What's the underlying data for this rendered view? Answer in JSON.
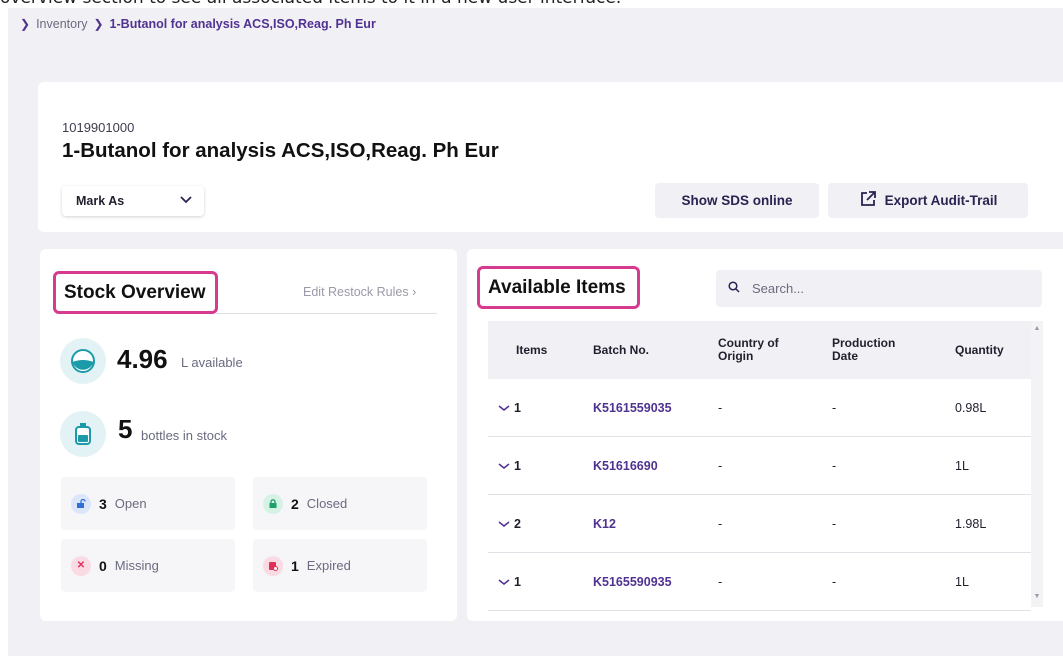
{
  "caption": "overview section to see all associated items to it in a new user interface.",
  "breadcrumb": {
    "items": [
      "Inventory",
      "1-Butanol for analysis ACS,ISO,Reag. Ph Eur"
    ]
  },
  "product": {
    "id": "1019901000",
    "title": "1-Butanol for analysis ACS,ISO,Reag. Ph Eur"
  },
  "header_actions": {
    "mark_as": "Mark As",
    "show_sds": "Show SDS online",
    "export_audit": "Export Audit-Trail"
  },
  "stock": {
    "title": "Stock Overview",
    "restock_link": "Edit Restock Rules",
    "available_value": "4.96",
    "available_unit": "L available",
    "bottles_value": "5",
    "bottles_unit": "bottles in stock",
    "statuses": [
      {
        "count": "3",
        "label": "Open",
        "icon": "unlock-icon",
        "color": "#2f6fd6"
      },
      {
        "count": "2",
        "label": "Closed",
        "icon": "lock-icon",
        "color": "#1f9e6a"
      },
      {
        "count": "0",
        "label": "Missing",
        "icon": "x-icon",
        "color": "#e0305a"
      },
      {
        "count": "1",
        "label": "Expired",
        "icon": "expired-icon",
        "color": "#e0305a"
      }
    ]
  },
  "available_items": {
    "title": "Available Items",
    "search_placeholder": "Search...",
    "columns": [
      "Items",
      "Batch No.",
      "Country of Origin",
      "Production Date",
      "Quantity"
    ],
    "rows": [
      {
        "items": "1",
        "batch": "K5161559035",
        "country": "-",
        "production_date": "-",
        "quantity": "0.98L"
      },
      {
        "items": "1",
        "batch": "K51616690",
        "country": "-",
        "production_date": "-",
        "quantity": "1L"
      },
      {
        "items": "2",
        "batch": "K12",
        "country": "-",
        "production_date": "-",
        "quantity": "1.98L"
      },
      {
        "items": "1",
        "batch": "K5165590935",
        "country": "-",
        "production_date": "-",
        "quantity": "1L"
      }
    ]
  },
  "colors": {
    "accent": "#503291",
    "highlight": "#d63b8f",
    "teal": "#1b9aaa"
  }
}
